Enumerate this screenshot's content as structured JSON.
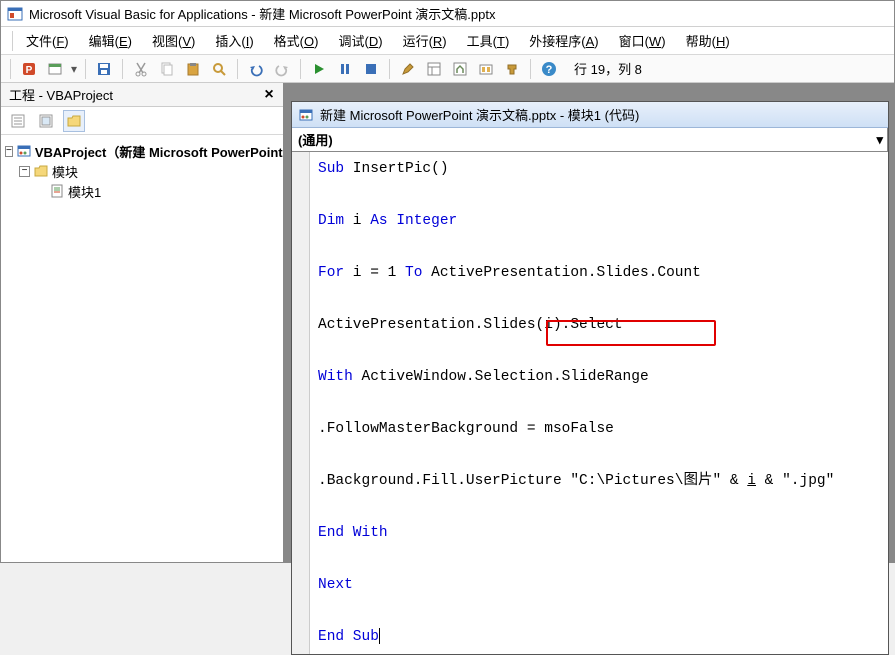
{
  "titlebar": {
    "title": "Microsoft Visual Basic for Applications - 新建 Microsoft PowerPoint 演示文稿.pptx"
  },
  "menus": {
    "file": "文件(F)",
    "edit": "编辑(E)",
    "view": "视图(V)",
    "insert": "插入(I)",
    "format": "格式(O)",
    "debug": "调试(D)",
    "run": "运行(R)",
    "tools": "工具(T)",
    "addins": "外接程序(A)",
    "window": "窗口(W)",
    "help": "帮助(H)"
  },
  "status": {
    "position": "行 19，列 8"
  },
  "project_panel": {
    "title": "工程 - VBAProject",
    "root": "VBAProject（新建 Microsoft PowerPoint 演示文稿.pptx）",
    "folder": "模块",
    "module": "模块1"
  },
  "code_window": {
    "title": "新建 Microsoft PowerPoint 演示文稿.pptx - 模块1 (代码)",
    "scope": "(通用)",
    "lines": {
      "l1a": "Sub",
      "l1b": " InsertPic()",
      "l2a": "Dim",
      "l2b": " i ",
      "l2c": "As Integer",
      "l3a": "For",
      "l3b": " i = 1 ",
      "l3c": "To",
      "l3d": " ActivePresentation.Slides.Count",
      "l4": "ActivePresentation.Slides(i).Select",
      "l5a": "With",
      "l5b": " ActiveWindow.Selection.SlideRange",
      "l6": ".FollowMasterBackground = msoFalse",
      "l7a": ".Background.Fill.UserPicture ",
      "l7b": "\"C:\\Pictures\\图片\"",
      "l7c": " & ",
      "l7d": "i",
      "l7e": " & ",
      "l7f": "\".jpg\"",
      "l8": "End With",
      "l9": "Next",
      "l10": "End Sub"
    }
  }
}
